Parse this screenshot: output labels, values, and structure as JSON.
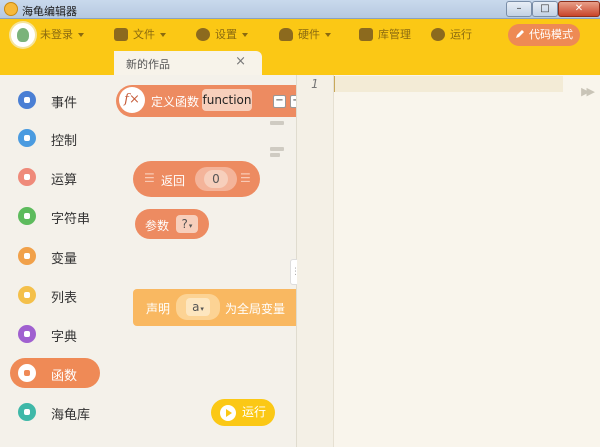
{
  "window": {
    "title": "海龟编辑器",
    "controls": [
      "–",
      "□",
      "✕"
    ]
  },
  "menubar": {
    "user": "未登录",
    "items": [
      {
        "label": "文件",
        "icon": "folder-icon",
        "dropdown": true
      },
      {
        "label": "设置",
        "icon": "gear-icon",
        "dropdown": true
      },
      {
        "label": "硬件",
        "icon": "hardware-icon",
        "dropdown": true
      },
      {
        "label": "库管理",
        "icon": "library-icon",
        "dropdown": false
      },
      {
        "label": "运行",
        "icon": "play-icon",
        "dropdown": false
      }
    ],
    "code_mode": "代码模式"
  },
  "tab": {
    "label": "新的作品",
    "close": "×"
  },
  "categories": [
    {
      "label": "事件",
      "color": "#4a7fd4"
    },
    {
      "label": "控制",
      "color": "#4a9be0"
    },
    {
      "label": "运算",
      "color": "#ef8a7a"
    },
    {
      "label": "字符串",
      "color": "#5dbb5d"
    },
    {
      "label": "变量",
      "color": "#f1a14a"
    },
    {
      "label": "列表",
      "color": "#f4c04a"
    },
    {
      "label": "字典",
      "color": "#a060d0"
    },
    {
      "label": "函数",
      "color": "#ef8a56"
    },
    {
      "label": "海龟库",
      "color": "#3fb8a8"
    }
  ],
  "active_category": "函数",
  "blocks": {
    "define_function": {
      "label": "定义函数",
      "name": "function",
      "minus": "−",
      "plus": "+"
    },
    "return": {
      "label": "返回",
      "value": "0"
    },
    "param": {
      "label": "参数",
      "value": "?"
    },
    "declare": {
      "label": "声明",
      "var": "a",
      "suffix": "为全局变量"
    }
  },
  "run_button": "运行",
  "editor": {
    "line_number": "1"
  }
}
